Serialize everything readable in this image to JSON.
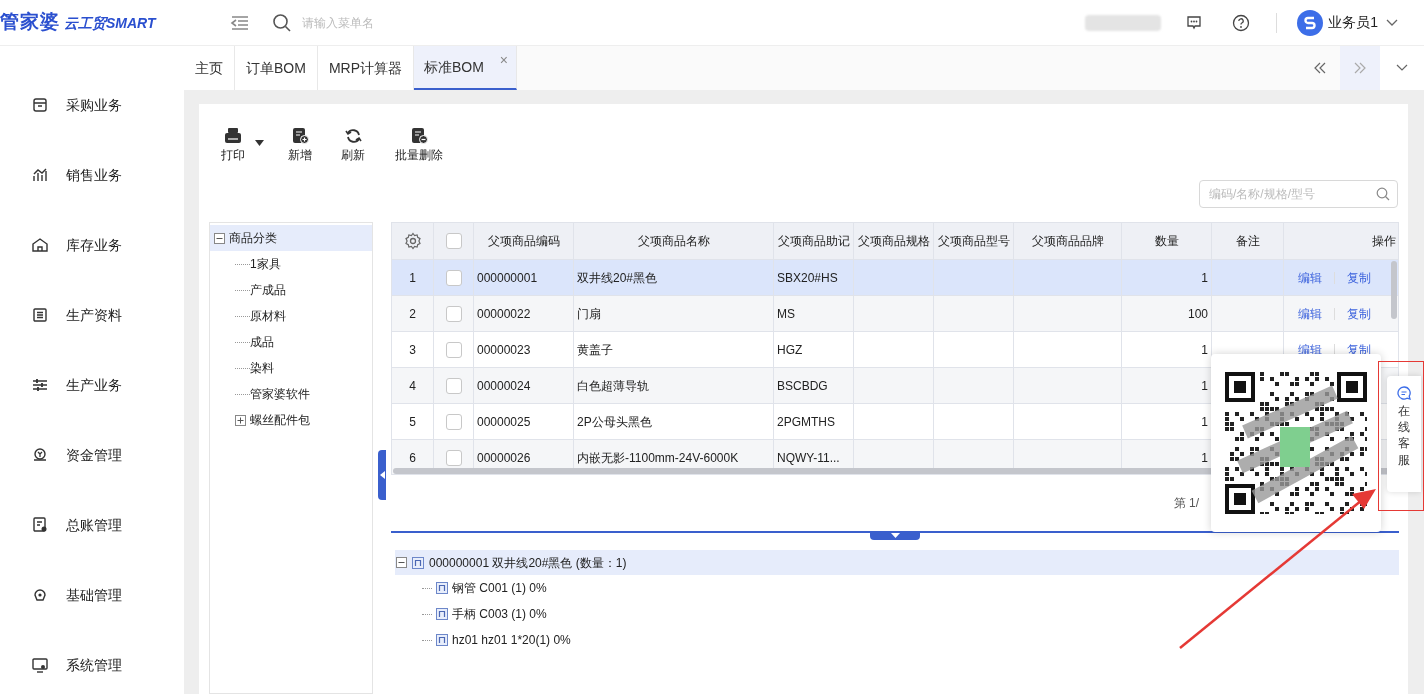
{
  "header": {
    "logo_main": "管家婆",
    "logo_sub": "云工贸SMART",
    "search_placeholder": "请输入菜单名",
    "user": "业务员1"
  },
  "sidebar": {
    "items": [
      {
        "label": "采购业务"
      },
      {
        "label": "销售业务"
      },
      {
        "label": "库存业务"
      },
      {
        "label": "生产资料"
      },
      {
        "label": "生产业务"
      },
      {
        "label": "资金管理"
      },
      {
        "label": "总账管理"
      },
      {
        "label": "基础管理"
      },
      {
        "label": "系统管理"
      }
    ]
  },
  "tabs": [
    {
      "label": "主页",
      "selected": false
    },
    {
      "label": "订单BOM",
      "selected": false
    },
    {
      "label": "MRP计算器",
      "selected": false
    },
    {
      "label": "标准BOM",
      "selected": true,
      "close": "×"
    }
  ],
  "toolbar": [
    {
      "label": "打印",
      "dropdown": true
    },
    {
      "label": "新增"
    },
    {
      "label": "刷新"
    },
    {
      "label": "批量删除"
    }
  ],
  "search": {
    "placeholder": "编码/名称/规格/型号"
  },
  "category_tree": {
    "items": [
      {
        "label": "商品分类",
        "selected": true,
        "expanded": true,
        "children": [
          {
            "label": "1家具",
            "selected": false
          },
          {
            "label": "产成品",
            "selected": false
          },
          {
            "label": "原材料",
            "selected": false
          },
          {
            "label": "成品",
            "selected": false
          },
          {
            "label": "染料",
            "selected": false
          },
          {
            "label": "管家婆软件",
            "selected": false
          },
          {
            "label": "螺丝配件包",
            "selected": false,
            "expanded": false
          }
        ]
      }
    ]
  },
  "table": {
    "header_checked": false,
    "columns": [
      "父项商品编码",
      "父项商品名称",
      "父项商品助记",
      "父项商品规格",
      "父项商品型号",
      "父项商品品牌",
      "数量",
      "备注",
      "操作"
    ],
    "rows": [
      {
        "index": "1",
        "selected": true,
        "checked": false,
        "code": "000000001",
        "name": "双井线20#黑色",
        "mnemonic": "SBX20#HS",
        "quantity": "1",
        "actions": [
          "编辑",
          "复制"
        ]
      },
      {
        "index": "2",
        "selected": false,
        "checked": false,
        "code": "00000022",
        "name": "门扇",
        "mnemonic": "MS",
        "quantity": "100",
        "actions": [
          "编辑",
          "复制"
        ]
      },
      {
        "index": "3",
        "selected": false,
        "checked": false,
        "code": "00000023",
        "name": "黄盖子",
        "mnemonic": "HGZ",
        "quantity": "1",
        "actions": [
          "编辑",
          "复制"
        ]
      },
      {
        "index": "4",
        "selected": false,
        "checked": false,
        "code": "00000024",
        "name": "白色超薄导轨",
        "mnemonic": "BSCBDG",
        "quantity": "1"
      },
      {
        "index": "5",
        "selected": false,
        "checked": false,
        "code": "00000025",
        "name": "2P公母头黑色",
        "mnemonic": "2PGMTHS",
        "quantity": "1"
      },
      {
        "index": "6",
        "selected": false,
        "checked": false,
        "code": "00000026",
        "name": "内嵌无影-1100mm-24V-6000K",
        "mnemonic": "NQWY-11...",
        "quantity": "1"
      }
    ]
  },
  "pagination": {
    "text": "第 1/"
  },
  "bom_tree": {
    "items": [
      {
        "label": "000000001 双井线20#黑色 (数量：1)",
        "selected": true,
        "expanded": true,
        "children": [
          {
            "label": "钢管 C001 (1) 0%"
          },
          {
            "label": "手柄 C003 (1) 0%"
          },
          {
            "label": "hz01 hz01 1*20(1) 0%"
          }
        ]
      }
    ]
  },
  "service_tab": {
    "label": "在线客服"
  }
}
